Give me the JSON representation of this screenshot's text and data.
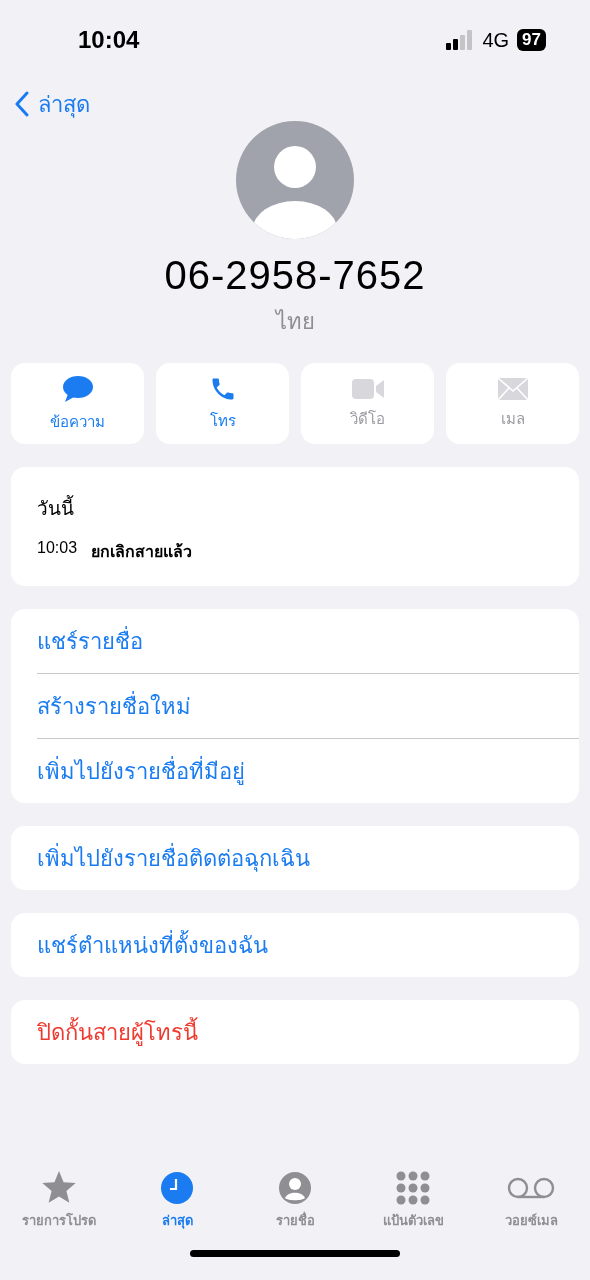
{
  "status_bar": {
    "time": "10:04",
    "network": "4G",
    "battery": "97"
  },
  "nav": {
    "back_label": "ล่าสุด"
  },
  "contact": {
    "number": "06-2958-7652",
    "region": "ไทย"
  },
  "actions": [
    {
      "kind": "message",
      "label": "ข้อความ",
      "disabled": false
    },
    {
      "kind": "call",
      "label": "โทร",
      "disabled": false
    },
    {
      "kind": "video",
      "label": "วิดีโอ",
      "disabled": true
    },
    {
      "kind": "mail",
      "label": "เมล",
      "disabled": true
    }
  ],
  "history": {
    "date": "วันนี้",
    "entries": [
      {
        "time": "10:03",
        "status": "ยกเลิกสายแล้ว"
      }
    ]
  },
  "menu_groups": [
    [
      {
        "label": "แชร์รายชื่อ",
        "kind": "normal"
      },
      {
        "label": "สร้างรายชื่อใหม่",
        "kind": "normal"
      },
      {
        "label": "เพิ่มไปยังรายชื่อที่มีอยู่",
        "kind": "normal"
      }
    ],
    [
      {
        "label": "เพิ่มไปยังรายชื่อติดต่อฉุกเฉิน",
        "kind": "normal"
      }
    ],
    [
      {
        "label": "แชร์ตำแหน่งที่ตั้งของฉัน",
        "kind": "normal"
      }
    ],
    [
      {
        "label": "ปิดกั้นสายผู้โทรนี้",
        "kind": "destructive"
      }
    ]
  ],
  "tab_bar": [
    {
      "kind": "favorites",
      "label": "รายการโปรด",
      "selected": false
    },
    {
      "kind": "recents",
      "label": "ล่าสุด",
      "selected": true
    },
    {
      "kind": "contacts",
      "label": "รายชื่อ",
      "selected": false
    },
    {
      "kind": "keypad",
      "label": "แป้นตัวเลข",
      "selected": false
    },
    {
      "kind": "voicemail",
      "label": "วอยซ์เมล",
      "selected": false
    }
  ]
}
